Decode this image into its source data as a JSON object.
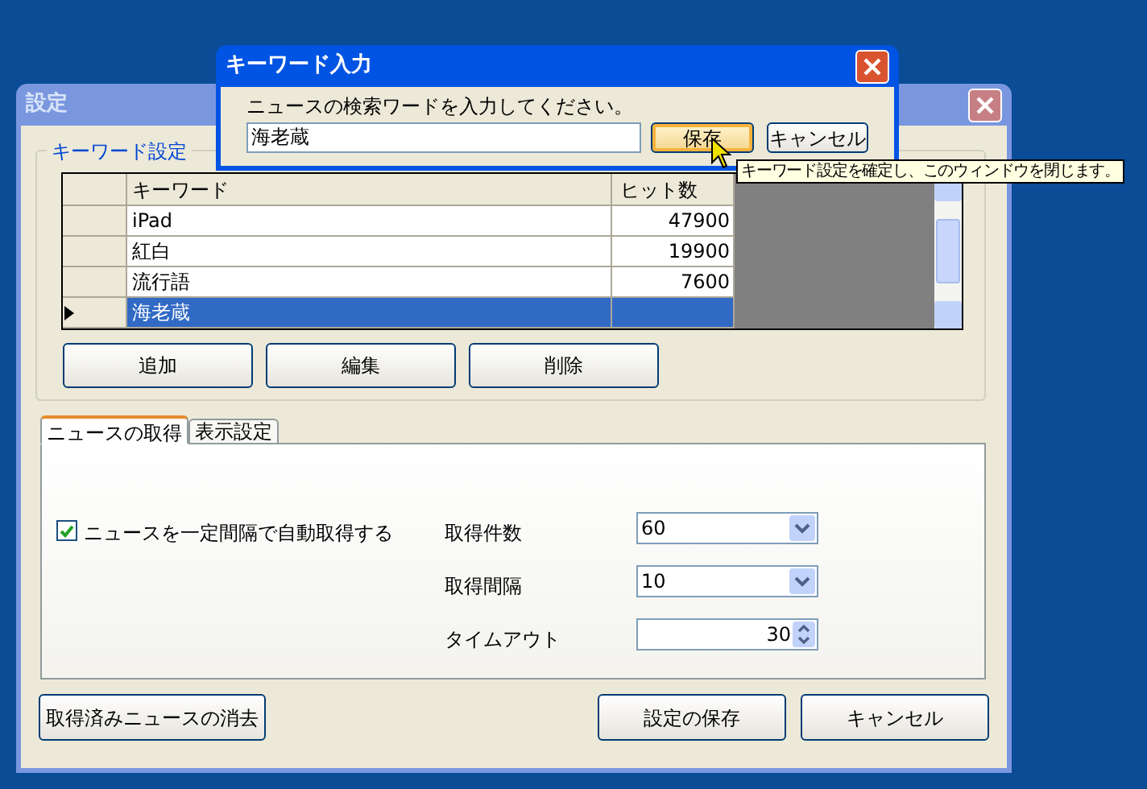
{
  "main_window": {
    "title": "設定",
    "active": false
  },
  "keyword_group": {
    "title": "キーワード設定"
  },
  "table": {
    "columns": [
      "キーワード",
      "ヒット数"
    ],
    "rows": [
      {
        "keyword": "iPad",
        "hits": "47900",
        "selected": false
      },
      {
        "keyword": "紅白",
        "hits": "19900",
        "selected": false
      },
      {
        "keyword": "流行語",
        "hits": "7600",
        "selected": false
      },
      {
        "keyword": "海老蔵",
        "selected": true
      }
    ]
  },
  "keyword_buttons": [
    "追加",
    "編集",
    "削除"
  ],
  "tabs": [
    {
      "label": "ニュースの取得",
      "selected": true
    },
    {
      "label": "表示設定",
      "selected": false
    }
  ],
  "auto_fetch": {
    "label": "ニュースを一定間隔で自動取得する",
    "checked": true
  },
  "fields": [
    {
      "kind": "dropdown",
      "label": "取得件数",
      "value": "60"
    },
    {
      "kind": "dropdown",
      "label": "取得間隔",
      "value": "10"
    },
    {
      "kind": "spinner",
      "label": "タイムアウト",
      "value": "30"
    }
  ],
  "bottom_buttons": [
    "取得済みニュースの消去",
    "設定の保存",
    "キャンセル"
  ],
  "dialog": {
    "title": "キーワード入力",
    "active": true,
    "prompt": "ニュースの検索ワードを入力してください。",
    "input_value": "海老蔵",
    "buttons": [
      {
        "label": "保存",
        "hovered": true
      },
      {
        "label": "キャンセル",
        "hovered": false
      }
    ]
  },
  "tooltip": "キーワード設定を確定し、このウィンドウを閉じます。"
}
